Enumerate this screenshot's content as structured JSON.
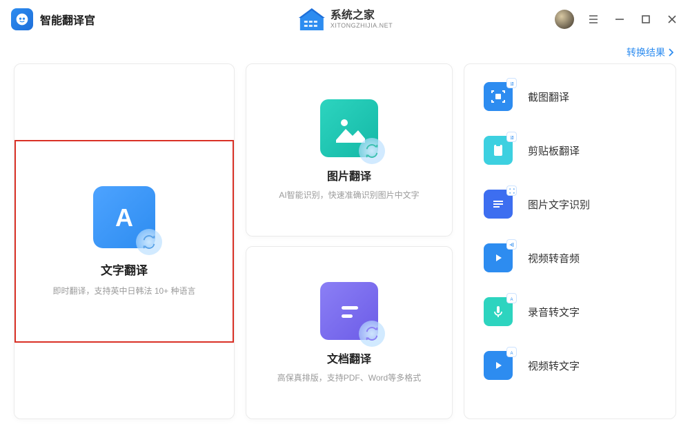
{
  "header": {
    "app_title": "智能翻译官",
    "brand_main": "系统之家",
    "brand_sub": "XITONGZHIJIA.NET"
  },
  "topbar": {
    "results_link": "转换结果"
  },
  "cards": {
    "text": {
      "title": "文字翻译",
      "subtitle": "即时翻译，支持英中日韩法 10+ 种语言"
    },
    "image": {
      "title": "图片翻译",
      "subtitle": "AI智能识别，快速准确识别图片中文字"
    },
    "document": {
      "title": "文档翻译",
      "subtitle": "高保真排版，支持PDF、Word等多格式"
    }
  },
  "side": {
    "items": [
      {
        "label": "截图翻译"
      },
      {
        "label": "剪贴板翻译"
      },
      {
        "label": "图片文字识别"
      },
      {
        "label": "视频转音频"
      },
      {
        "label": "录音转文字"
      },
      {
        "label": "视频转文字"
      }
    ]
  }
}
